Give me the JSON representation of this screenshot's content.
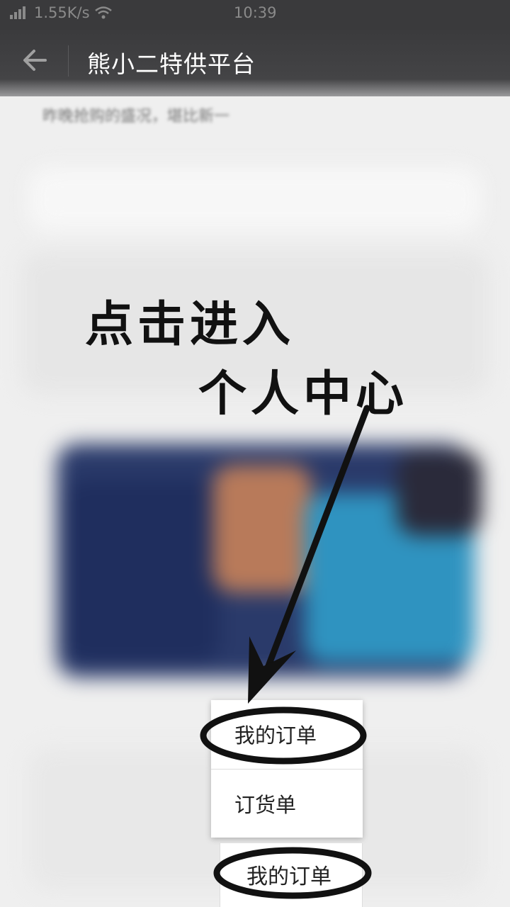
{
  "status_bar": {
    "network_speed": "1.55K/s",
    "time": "10:39"
  },
  "header": {
    "title": "熊小二特供平台"
  },
  "article": {
    "snippet": "昨晚抢购的盛况，堪比新一"
  },
  "annotation": {
    "line1": "点击进入",
    "line2": "个人中心"
  },
  "popup_menu": {
    "items": [
      {
        "label": "我的订单"
      },
      {
        "label": "订货单"
      }
    ]
  },
  "bottom_nav": {
    "personal_tab_label": "我的订单"
  },
  "colors": {
    "annotation_ink": "#111111",
    "header_bg": "#3a3a3c"
  }
}
